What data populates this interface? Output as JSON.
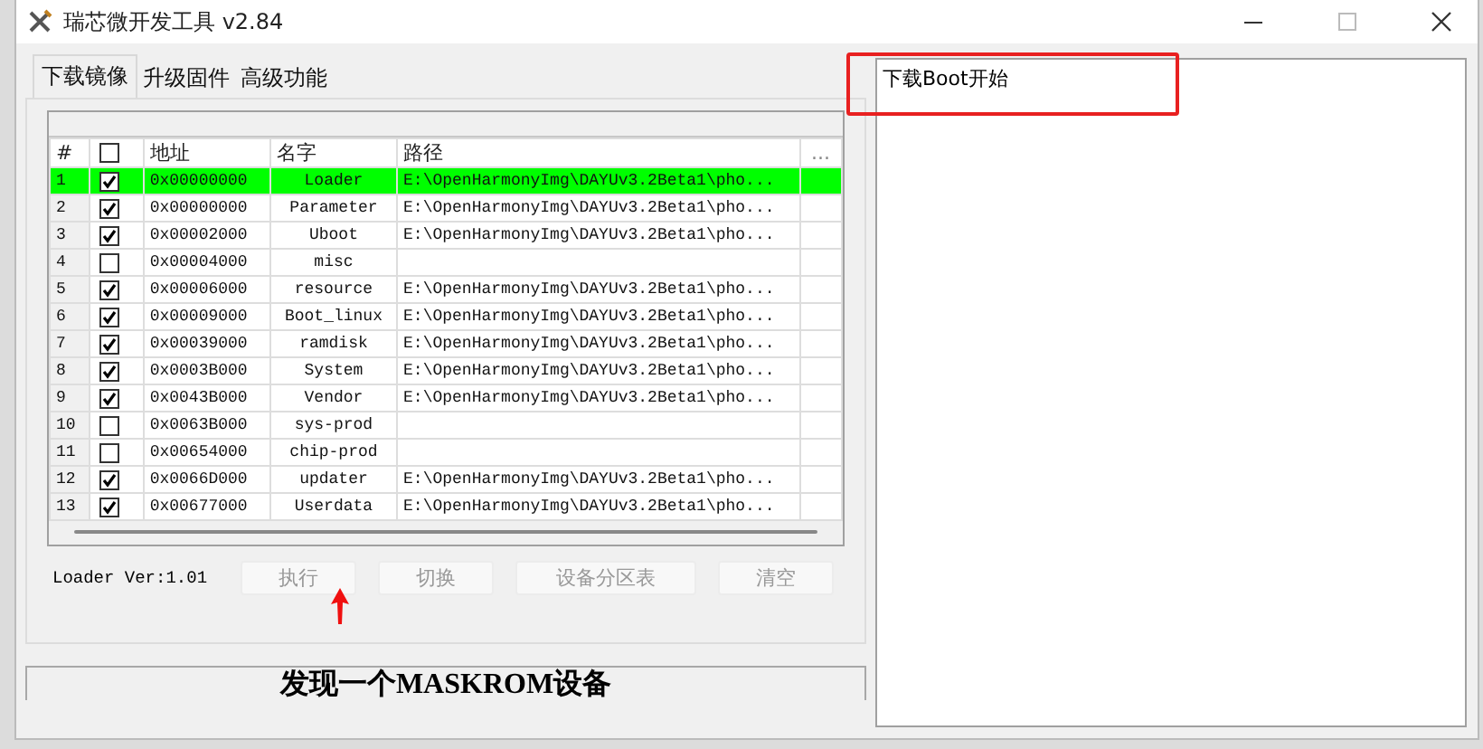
{
  "window": {
    "title": "瑞芯微开发工具 v2.84"
  },
  "tabs": [
    {
      "label": "下载镜像",
      "selected": true
    },
    {
      "label": "升级固件",
      "selected": false
    },
    {
      "label": "高级功能",
      "selected": false
    }
  ],
  "table": {
    "columns": [
      "#",
      "地址",
      "名字",
      "路径",
      "..."
    ],
    "select_all_checked": false,
    "rows": [
      {
        "index": "1",
        "checked": true,
        "address": "0x00000000",
        "name": "Loader",
        "path": "E:\\OpenHarmonyImg\\DAYUv3.2Beta1\\pho...",
        "selected": true
      },
      {
        "index": "2",
        "checked": true,
        "address": "0x00000000",
        "name": "Parameter",
        "path": "E:\\OpenHarmonyImg\\DAYUv3.2Beta1\\pho...",
        "selected": false
      },
      {
        "index": "3",
        "checked": true,
        "address": "0x00002000",
        "name": "Uboot",
        "path": "E:\\OpenHarmonyImg\\DAYUv3.2Beta1\\pho...",
        "selected": false
      },
      {
        "index": "4",
        "checked": false,
        "address": "0x00004000",
        "name": "misc",
        "selected": false
      },
      {
        "index": "5",
        "checked": true,
        "address": "0x00006000",
        "name": "resource",
        "path": "E:\\OpenHarmonyImg\\DAYUv3.2Beta1\\pho...",
        "selected": false
      },
      {
        "index": "6",
        "checked": true,
        "address": "0x00009000",
        "name": "Boot_linux",
        "path": "E:\\OpenHarmonyImg\\DAYUv3.2Beta1\\pho...",
        "selected": false
      },
      {
        "index": "7",
        "checked": true,
        "address": "0x00039000",
        "name": "ramdisk",
        "path": "E:\\OpenHarmonyImg\\DAYUv3.2Beta1\\pho...",
        "selected": false
      },
      {
        "index": "8",
        "checked": true,
        "address": "0x0003B000",
        "name": "System",
        "path": "E:\\OpenHarmonyImg\\DAYUv3.2Beta1\\pho...",
        "selected": false
      },
      {
        "index": "9",
        "checked": true,
        "address": "0x0043B000",
        "name": "Vendor",
        "path": "E:\\OpenHarmonyImg\\DAYUv3.2Beta1\\pho...",
        "selected": false
      },
      {
        "index": "10",
        "checked": false,
        "address": "0x0063B000",
        "name": "sys-prod",
        "selected": false
      },
      {
        "index": "11",
        "checked": false,
        "address": "0x00654000",
        "name": "chip-prod",
        "selected": false
      },
      {
        "index": "12",
        "checked": true,
        "address": "0x0066D000",
        "name": "updater",
        "path": "E:\\OpenHarmonyImg\\DAYUv3.2Beta1\\pho...",
        "selected": false
      },
      {
        "index": "13",
        "checked": true,
        "address": "0x00677000",
        "name": "Userdata",
        "path": "E:\\OpenHarmonyImg\\DAYUv3.2Beta1\\pho...",
        "selected": false
      }
    ]
  },
  "loader_version": "Loader Ver:1.01",
  "buttons": [
    {
      "label": "执行",
      "disabled": true
    },
    {
      "label": "切换",
      "disabled": true
    },
    {
      "label": "设备分区表",
      "disabled": true
    },
    {
      "label": "清空",
      "disabled": true
    }
  ],
  "status_bar": "发现一个MASKROM设备",
  "log": [
    "下载Boot开始"
  ]
}
